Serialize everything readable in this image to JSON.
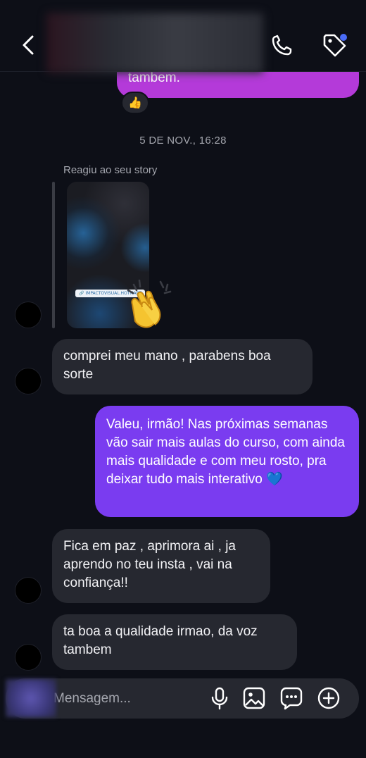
{
  "header": {
    "back_icon": "chevron-left-icon",
    "call_icon": "phone-icon",
    "tag_icon": "tag-icon",
    "tag_badge_color": "#4a6cf7"
  },
  "previous_message": {
    "text": "tambem.",
    "color": "#b43ad9",
    "reaction": "👍"
  },
  "timestamp": "5 DE NOV., 16:28",
  "story_reply": {
    "label": "Reagiu ao seu story",
    "story_tag": "🔗 IMPACTOVISUAL.HOTMART",
    "reaction": "clapping-hands"
  },
  "messages": [
    {
      "direction": "in",
      "text": "comprei meu mano , parabens boa sorte"
    },
    {
      "direction": "out",
      "text": "Valeu, irmão! Nas próximas semanas vão sair mais aulas do curso, com ainda mais qualidade e com meu rosto, pra deixar tudo mais interativo 💙"
    },
    {
      "direction": "in",
      "text": "Fica em paz , aprimora ai , ja aprendo no teu insta , vai na confiança!!"
    },
    {
      "direction": "in",
      "text": "ta boa a qualidade irmao, da voz tambem"
    }
  ],
  "composer": {
    "placeholder": "Mensagem...",
    "icons": [
      "microphone-icon",
      "image-icon",
      "sticker-icon",
      "plus-icon"
    ]
  },
  "colors": {
    "background": "#0d0f17",
    "incoming_bubble": "#262830",
    "outgoing_bubble": "#7a3cf0"
  }
}
